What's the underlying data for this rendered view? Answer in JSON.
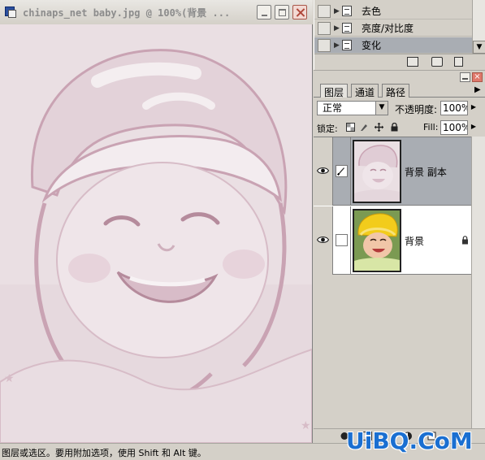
{
  "document": {
    "title": "chinaps_net baby.jpg @ 100%(背景 ..."
  },
  "actions": {
    "items": [
      {
        "label": "去色"
      },
      {
        "label": "亮度/对比度"
      },
      {
        "label": "变化"
      }
    ],
    "selected": "变化"
  },
  "layers_panel": {
    "tabs": [
      {
        "label": "图层"
      },
      {
        "label": "通道"
      },
      {
        "label": "路径"
      }
    ],
    "blend_mode": "正常",
    "opacity_label": "不透明度:",
    "opacity_value": "100%",
    "lock_label": "锁定:",
    "fill_label": "Fill:",
    "fill_value": "100%",
    "layers": [
      {
        "name": "背景 副本",
        "selected": true
      },
      {
        "name": "背景",
        "selected": false,
        "locked": true
      }
    ]
  },
  "status_bar": {
    "text": "图层或选区。要用附加选项，使用 Shift 和 Alt 键。"
  },
  "watermark": {
    "text": "UiBQ.CoM"
  },
  "colors": {
    "canvas_tint": "#eadfe3",
    "photo_line": "#c9a3b3",
    "selected_row": "#a9adb3",
    "watermark": "#1a6fd1"
  }
}
